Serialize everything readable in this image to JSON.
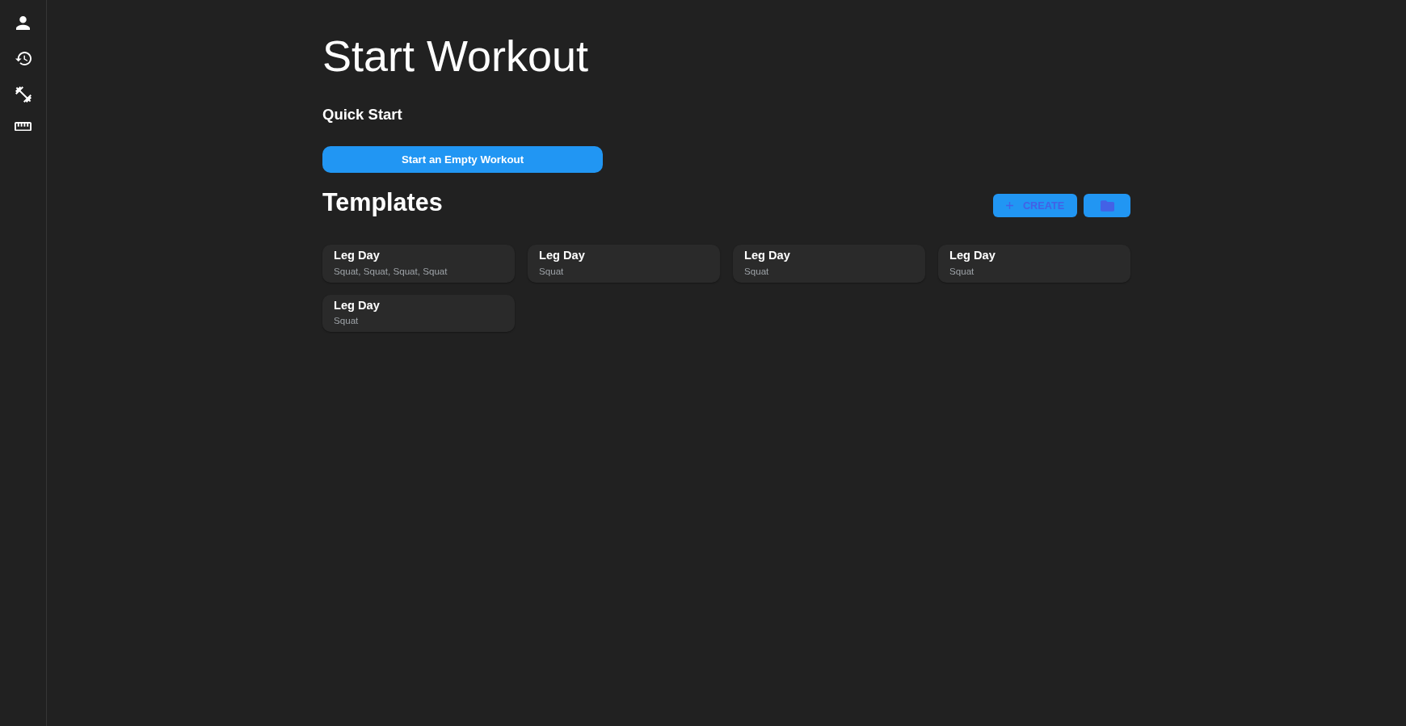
{
  "sidebar": {
    "items": [
      {
        "kind": "person"
      },
      {
        "kind": "history"
      },
      {
        "kind": "dumbbell"
      },
      {
        "kind": "ruler"
      }
    ]
  },
  "page": {
    "title": "Start Workout",
    "quick_start": {
      "heading": "Quick Start",
      "button": "Start an Empty Workout"
    },
    "templates": {
      "heading": "Templates",
      "actions": [
        {
          "kind": "create",
          "label": "CREATE"
        },
        {
          "kind": "folder"
        }
      ],
      "items": [
        {
          "name": "Leg Day",
          "exercises": "Squat, Squat, Squat, Squat"
        },
        {
          "name": "Leg Day",
          "exercises": "Squat"
        },
        {
          "name": "Leg Day",
          "exercises": "Squat"
        },
        {
          "name": "Leg Day",
          "exercises": "Squat"
        },
        {
          "name": "Leg Day",
          "exercises": "Squat"
        }
      ]
    }
  }
}
